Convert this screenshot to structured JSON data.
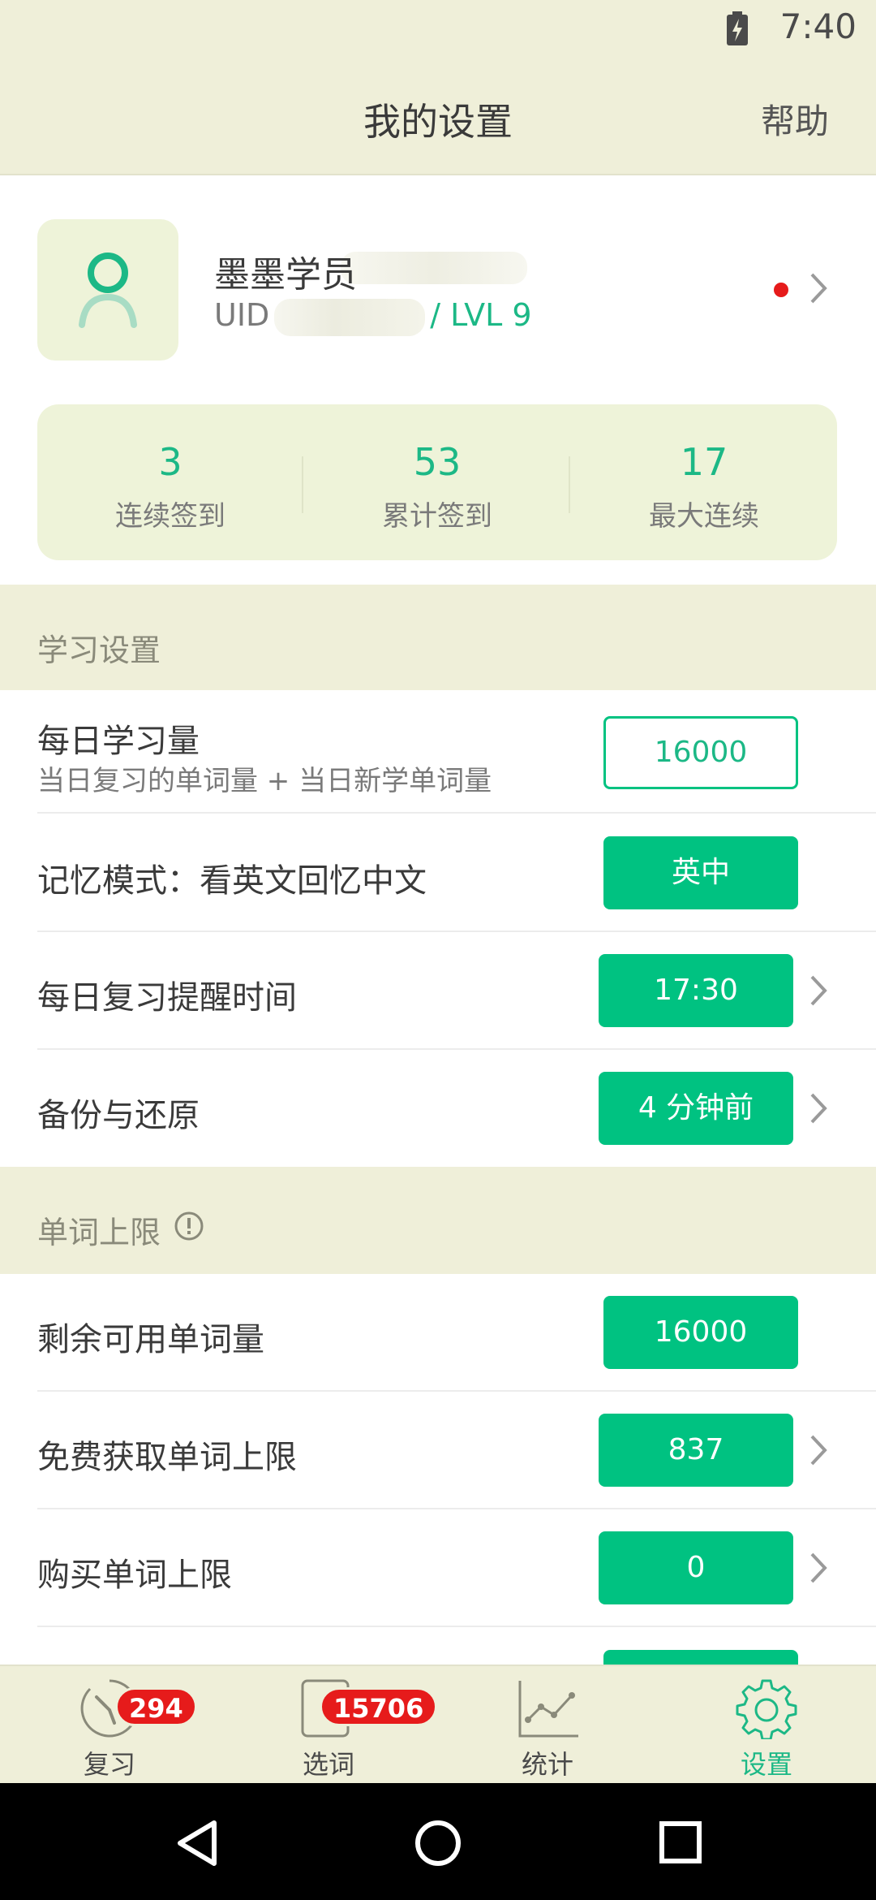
{
  "status_bar": {
    "time": "7:40"
  },
  "header": {
    "title": "我的设置",
    "help": "帮助"
  },
  "profile": {
    "name": "墨墨学员",
    "uid_prefix": "UID",
    "level": "/ LVL 9"
  },
  "stats": [
    {
      "value": "3",
      "label": "连续签到"
    },
    {
      "value": "53",
      "label": "累计签到"
    },
    {
      "value": "17",
      "label": "最大连续"
    }
  ],
  "study_section": {
    "title": "学习设置",
    "daily_amount": {
      "label": "每日学习量",
      "sub": "当日复习的单词量 + 当日新学单词量",
      "value": "16000"
    },
    "memory_mode": {
      "label": "记忆模式：看英文回忆中文",
      "value": "英中"
    },
    "reminder": {
      "label": "每日复习提醒时间",
      "value": "17:30"
    },
    "backup": {
      "label": "备份与还原",
      "value": "4 分钟前"
    }
  },
  "limit_section": {
    "title": "单词上限",
    "remaining": {
      "label": "剩余可用单词量",
      "value": "16000"
    },
    "free": {
      "label": "免费获取单词上限",
      "value": "837"
    },
    "buy": {
      "label": "购买单词上限",
      "value": "0"
    }
  },
  "tabs": [
    {
      "label": "复习",
      "badge": "294"
    },
    {
      "label": "选词",
      "badge": "15706"
    },
    {
      "label": "统计"
    },
    {
      "label": "设置"
    }
  ],
  "colors": {
    "accent": "#00c281",
    "header_bg": "#efefd9",
    "badge": "#e61b1b"
  }
}
